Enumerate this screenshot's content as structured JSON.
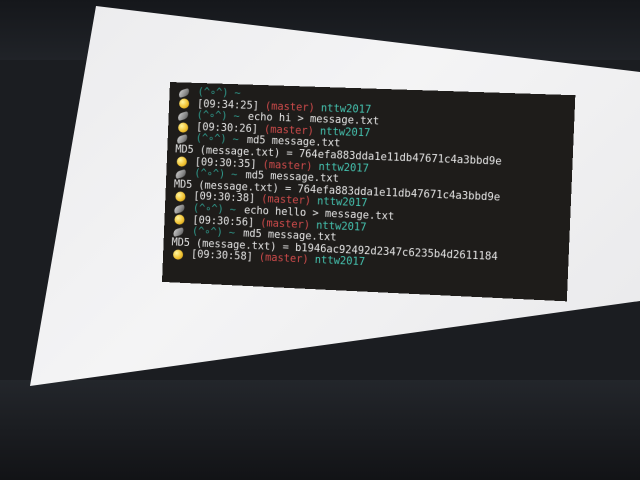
{
  "colors": {
    "terminal_bg": "#1e1c1a",
    "text": "#e6e6e6",
    "branch": "#cf4b4b",
    "project": "#45c3b0",
    "face": "#2f9a8c"
  },
  "terminal": {
    "lines": [
      {
        "kind": "face",
        "icon": "bird-icon",
        "face": "(^∘^)",
        "tilde": "~",
        "command": ""
      },
      {
        "kind": "status",
        "icon": "egg-icon",
        "time": "[09:34:25]",
        "branch": "(master)",
        "project": "nttw2017"
      },
      {
        "kind": "face",
        "icon": "bird-icon",
        "face": "(^∘^)",
        "tilde": "~",
        "command": "echo hi > message.txt"
      },
      {
        "kind": "status",
        "icon": "egg-icon",
        "time": "[09:30:26]",
        "branch": "(master)",
        "project": "nttw2017"
      },
      {
        "kind": "face",
        "icon": "bird-icon",
        "face": "(^∘^)",
        "tilde": "~",
        "command": "md5 message.txt"
      },
      {
        "kind": "output",
        "icon": "",
        "text": "MD5 (message.txt) = 764efa883dda1e11db47671c4a3bbd9e"
      },
      {
        "kind": "status",
        "icon": "egg-icon",
        "time": "[09:30:35]",
        "branch": "(master)",
        "project": "nttw2017"
      },
      {
        "kind": "face",
        "icon": "bird-icon",
        "face": "(^∘^)",
        "tilde": "~",
        "command": "md5 message.txt"
      },
      {
        "kind": "output",
        "icon": "",
        "text": "MD5 (message.txt) = 764efa883dda1e11db47671c4a3bbd9e"
      },
      {
        "kind": "status",
        "icon": "egg-icon",
        "time": "[09:30:38]",
        "branch": "(master)",
        "project": "nttw2017"
      },
      {
        "kind": "face",
        "icon": "bird-icon",
        "face": "(^∘^)",
        "tilde": "~",
        "command": "echo hello > message.txt"
      },
      {
        "kind": "status",
        "icon": "egg-icon",
        "time": "[09:30:56]",
        "branch": "(master)",
        "project": "nttw2017"
      },
      {
        "kind": "face",
        "icon": "bird-icon",
        "face": "(^∘^)",
        "tilde": "~",
        "command": "md5 message.txt"
      },
      {
        "kind": "output",
        "icon": "",
        "text": "MD5 (message.txt) = b1946ac92492d2347c6235b4d2611184"
      },
      {
        "kind": "status",
        "icon": "egg-icon",
        "time": "[09:30:58]",
        "branch": "(master)",
        "project": "nttw2017"
      }
    ]
  }
}
